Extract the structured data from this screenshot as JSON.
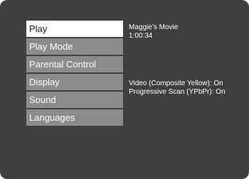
{
  "menu": {
    "items": [
      {
        "label": "Play",
        "selected": true
      },
      {
        "label": "Play Mode",
        "selected": false
      },
      {
        "label": "Parental Control",
        "selected": false
      },
      {
        "label": "Display",
        "selected": false
      },
      {
        "label": "Sound",
        "selected": false
      },
      {
        "label": "Languages",
        "selected": false
      }
    ]
  },
  "info": {
    "title": "Maggie’s Movie",
    "time": "1:00:34",
    "video_output": "Video (Composite Yellow): On",
    "progressive_scan": "Progressive Scan (YPbPr): On"
  },
  "colors": {
    "background": "#3f3f41",
    "menu_item": "#8b8b8d",
    "menu_selected": "#ffffff",
    "text": "#ffffff"
  }
}
